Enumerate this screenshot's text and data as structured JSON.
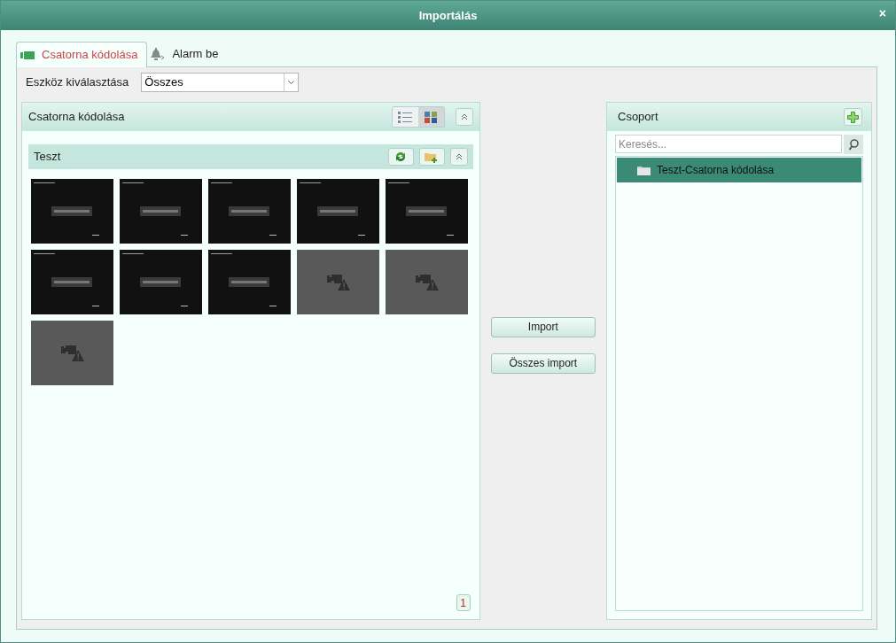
{
  "window": {
    "title": "Importálás",
    "close": "×"
  },
  "tabs": [
    {
      "kind": "channel",
      "label": "Csatorna kódolása",
      "selected": true
    },
    {
      "kind": "alarm",
      "label": "Alarm be",
      "selected": false
    }
  ],
  "device_select": {
    "label": "Eszköz kiválasztása",
    "value": "Összes"
  },
  "channel_panel": {
    "title": "Csatorna kódolása",
    "views": [
      {
        "kind": "list",
        "selected": false
      },
      {
        "kind": "grid",
        "selected": true
      }
    ],
    "group": {
      "title": "Teszt"
    },
    "tiles": [
      {
        "kind": "no_video"
      },
      {
        "kind": "no_video"
      },
      {
        "kind": "no_video"
      },
      {
        "kind": "no_video"
      },
      {
        "kind": "no_video"
      },
      {
        "kind": "no_video"
      },
      {
        "kind": "no_video"
      },
      {
        "kind": "no_video"
      },
      {
        "kind": "offline"
      },
      {
        "kind": "offline"
      },
      {
        "kind": "offline"
      }
    ],
    "page": "1"
  },
  "buttons": [
    "Import",
    "Összes import"
  ],
  "group_panel": {
    "title": "Csoport",
    "search": {
      "placeholder": "Keresés..."
    },
    "items": [
      {
        "label": "Teszt-Csatorna kódolása",
        "selected": true
      }
    ]
  }
}
